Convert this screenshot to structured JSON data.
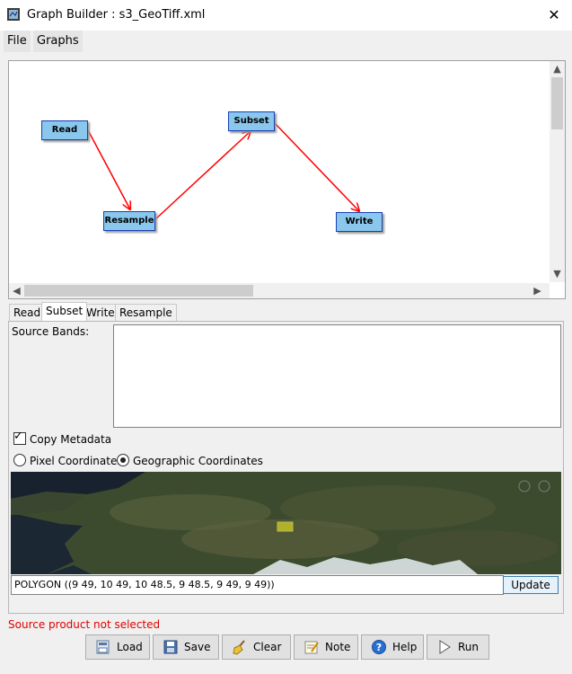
{
  "window": {
    "title": "Graph Builder : s3_GeoTiff.xml",
    "close_glyph": "✕"
  },
  "menu": {
    "file": "File",
    "graphs": "Graphs"
  },
  "graph": {
    "nodes": [
      {
        "id": "read",
        "label": "Read"
      },
      {
        "id": "resample",
        "label": "Resample"
      },
      {
        "id": "subset",
        "label": "Subset"
      },
      {
        "id": "write",
        "label": "Write"
      }
    ],
    "edge_color": "#ff0000",
    "node_color": "#89c7ec"
  },
  "tabs": [
    "Read",
    "Subset",
    "Write",
    "Resample"
  ],
  "subset": {
    "source_bands_label": "Source Bands:",
    "copy_metadata_label": "Copy Metadata",
    "copy_metadata_checked": true,
    "pixel_coords_label": "Pixel Coordinates",
    "geo_coords_label": "Geographic Coordinates",
    "selected_coords": "geographic",
    "polygon": "POLYGON ((9 49, 10 49, 10 48.5, 9 48.5, 9 49, 9 49))",
    "update_label": "Update"
  },
  "status": {
    "text": "Source product not selected",
    "color": "#e00000"
  },
  "buttons": {
    "load": "Load",
    "save": "Save",
    "clear": "Clear",
    "note": "Note",
    "help": "Help",
    "run": "Run"
  },
  "icons": {
    "app": "graph-builder-icon",
    "load": "load-icon",
    "save": "save-icon",
    "clear": "broom-icon",
    "note": "note-icon",
    "help": "help-icon",
    "run": "play-icon"
  }
}
